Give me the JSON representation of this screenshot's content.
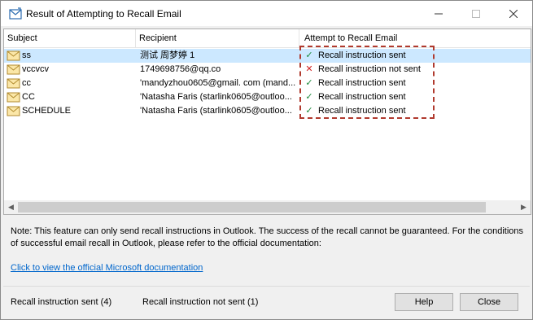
{
  "window": {
    "title": "Result of Attempting to Recall Email"
  },
  "table": {
    "columns": [
      "Subject",
      "Recipient",
      "Attempt to Recall Email"
    ],
    "rows": [
      {
        "subject": "ss",
        "recipient": "测试 周梦婷 1",
        "status": "ok",
        "attempt": "Recall instruction sent",
        "selected": true
      },
      {
        "subject": "vccvcv",
        "recipient": "1749698756@qq.co",
        "status": "bad",
        "attempt": "Recall instruction not sent",
        "selected": false
      },
      {
        "subject": "cc",
        "recipient": "'mandyzhou0605@gmail. com (mand...",
        "status": "ok",
        "attempt": "Recall instruction sent",
        "selected": false
      },
      {
        "subject": "CC",
        "recipient": "'Natasha Faris (starlink0605@outloo...",
        "status": "ok",
        "attempt": "Recall instruction sent",
        "selected": false
      },
      {
        "subject": "SCHEDULE",
        "recipient": "'Natasha Faris (starlink0605@outloo...",
        "status": "ok",
        "attempt": "Recall instruction sent",
        "selected": false
      }
    ]
  },
  "note": "Note: This feature can only send recall instructions in Outlook. The success of the recall cannot be guaranteed. For the conditions of successful email recall in Outlook, please refer to the official documentation:",
  "link": "Click to view the official Microsoft documentation",
  "stats": {
    "sent": "Recall instruction sent (4)",
    "not_sent": "Recall instruction not sent (1)"
  },
  "buttons": {
    "help": "Help",
    "close": "Close"
  },
  "colors": {
    "selected_row": "#cce8ff",
    "link": "#0066cc",
    "highlight": "#b03a2e",
    "ok": "#1a8a3a",
    "bad": "#d02020"
  }
}
